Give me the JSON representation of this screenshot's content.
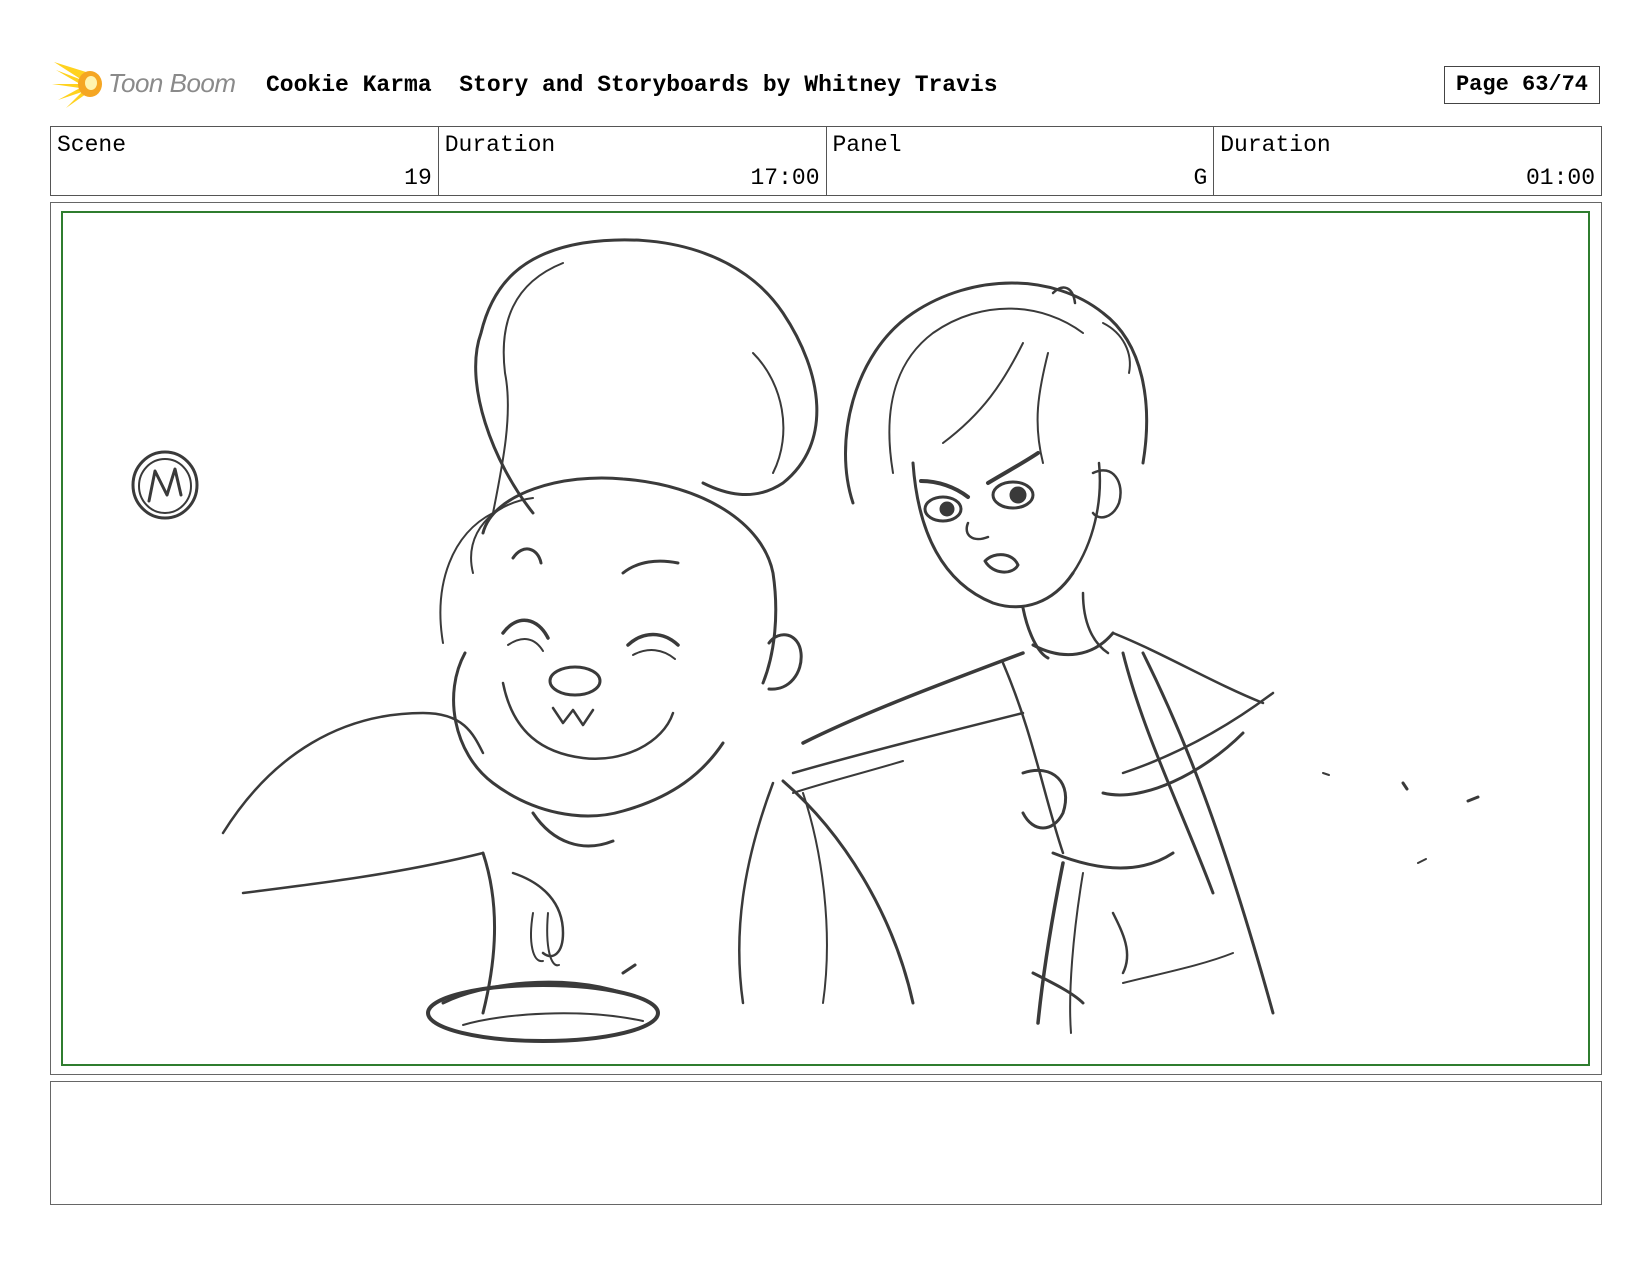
{
  "header": {
    "logo_text": "Toon Boom",
    "title": "Cookie Karma  Story and Storyboards by Whitney Travis",
    "page_label": "Page 63/74"
  },
  "info": {
    "scene_label": "Scene",
    "scene_value": "19",
    "scene_duration_label": "Duration",
    "scene_duration_value": "17:00",
    "panel_label": "Panel",
    "panel_value": "G",
    "panel_duration_label": "Duration",
    "panel_duration_value": "01:00"
  },
  "notes": {
    "text": ""
  },
  "colors": {
    "frame_border": "#2f7d2f",
    "logo_orange": "#f5a623",
    "logo_yellow": "#ffd21f"
  },
  "icons": {
    "logo": "toon-boom-star-icon"
  }
}
